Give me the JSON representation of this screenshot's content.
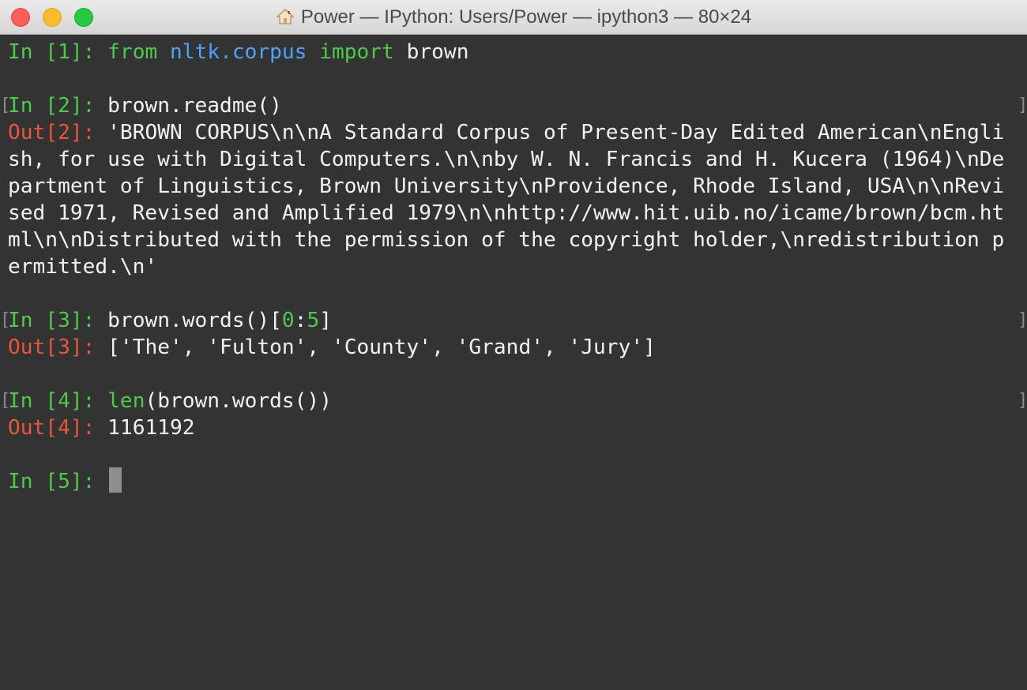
{
  "window": {
    "title": "Power — IPython: Users/Power — ipython3 — 80×24",
    "close_glyph": "×"
  },
  "session": {
    "in1": {
      "prompt": "In [1]:",
      "kw_from": "from",
      "module": "nltk.corpus",
      "kw_import": "import",
      "name": "brown"
    },
    "in2": {
      "prompt": "In [2]:",
      "code": "brown.readme()"
    },
    "out2": {
      "prompt": "Out[2]:",
      "lines": [
        "'BROWN CORPUS\\n\\nA Standard Corpus of Present-Day Edited American\\nEngli",
        "sh, for use with Digital Computers.\\n\\nby W. N. Francis and H. Kucera (1964)\\nDe",
        "partment of Linguistics, Brown University\\nProvidence, Rhode Island, USA\\n\\nRevi",
        "sed 1971, Revised and Amplified 1979\\n\\nhttp://www.hit.uib.no/icame/brown/bcm.ht",
        "ml\\n\\nDistributed with the permission of the copyright holder,\\nredistribution p",
        "ermitted.\\n'"
      ]
    },
    "in3": {
      "prompt": "In [3]:",
      "code_a": "brown.words()[",
      "num_a": "0",
      "colon": ":",
      "num_b": "5",
      "code_b": "]"
    },
    "out3": {
      "prompt": "Out[3]:",
      "value": "['The', 'Fulton', 'County', 'Grand', 'Jury']"
    },
    "in4": {
      "prompt": "In [4]:",
      "builtin": "len",
      "code": "(brown.words())"
    },
    "out4": {
      "prompt": "Out[4]:",
      "value": "1161192"
    },
    "in5": {
      "prompt": "In [5]:"
    },
    "bracket_open": "[",
    "bracket_close": "]"
  },
  "colors": {
    "prompt_green": "#4ec94e",
    "out_red": "#e8553d",
    "module_blue": "#4fa3ff",
    "text": "#f2f2f2",
    "background": "#333333"
  }
}
